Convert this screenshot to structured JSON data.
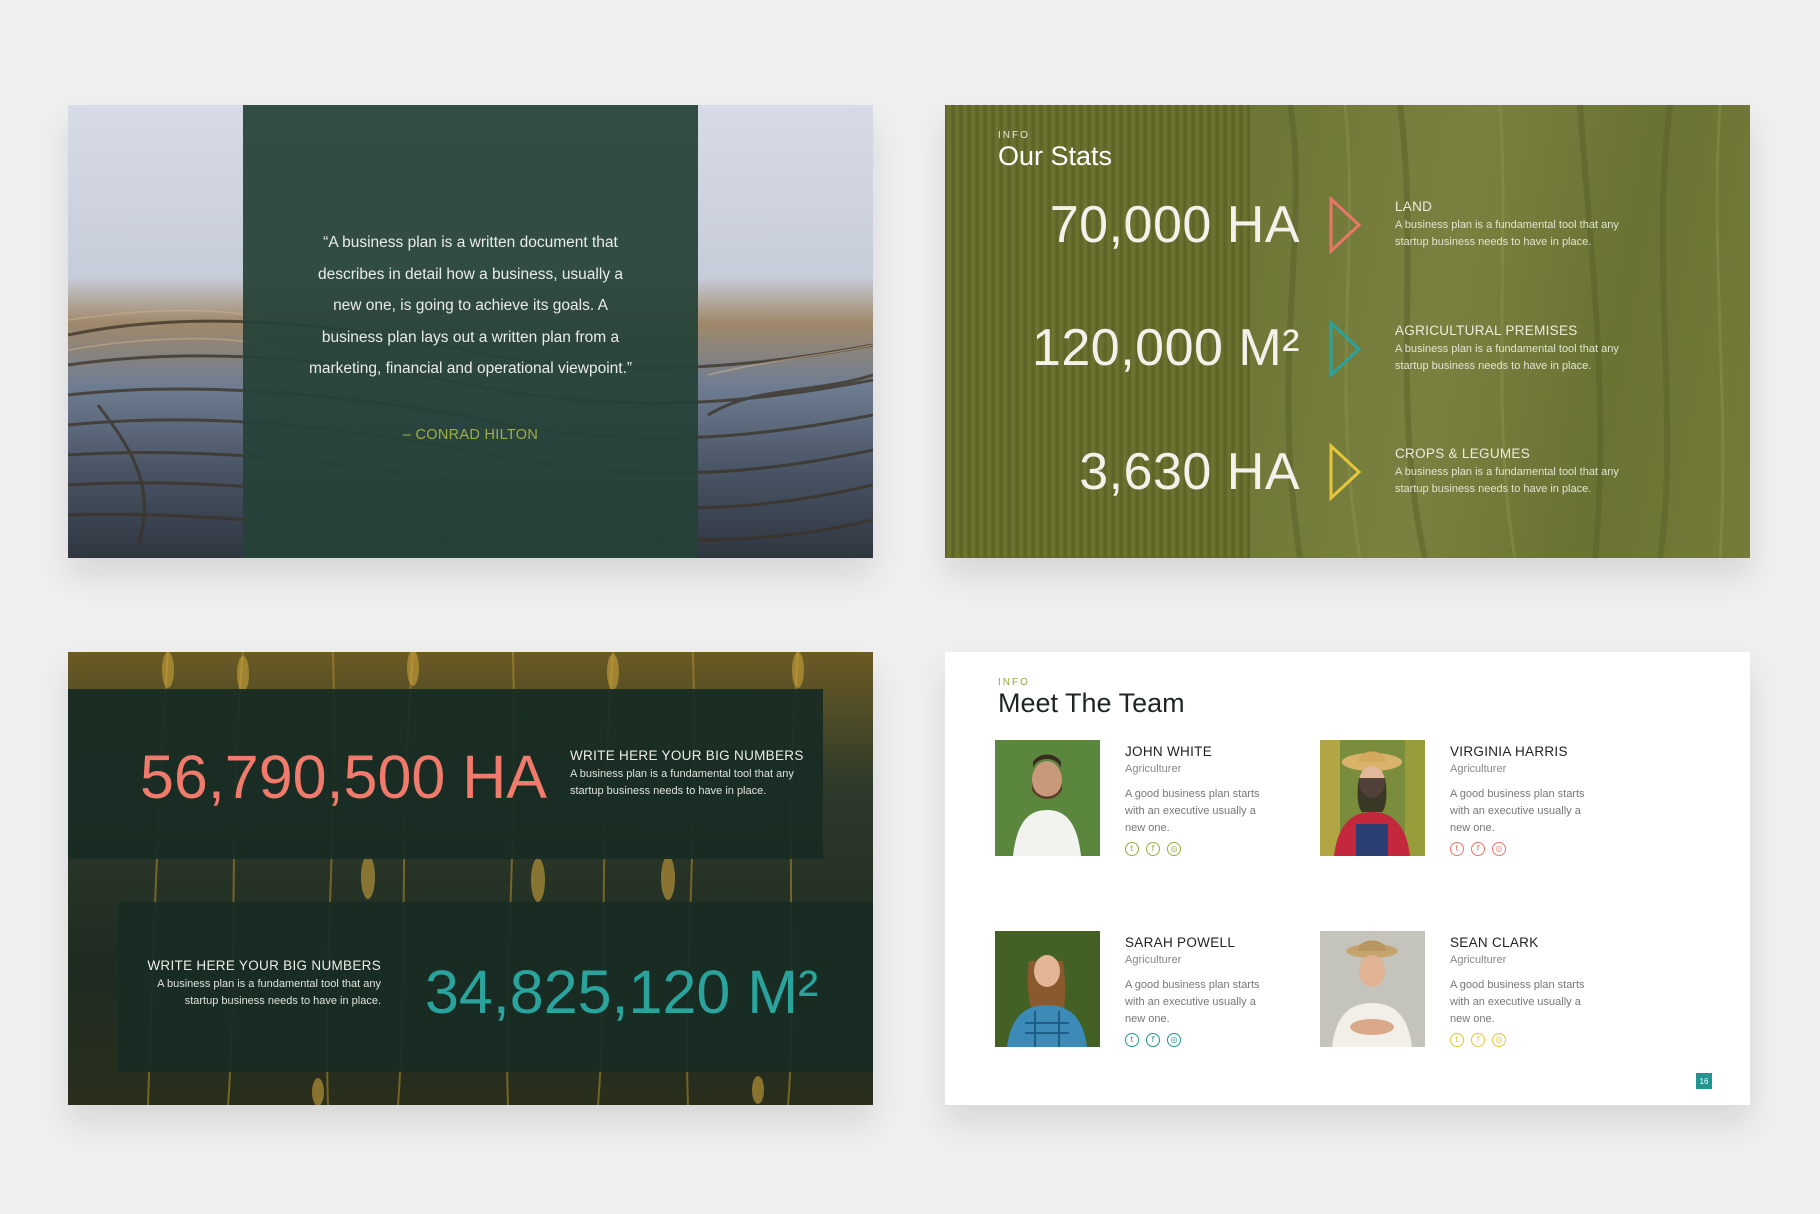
{
  "quote_slide": {
    "quote": "“A business plan is a written document that describes in detail how a business, usually a new one, is going to achieve its goals. A business plan lays out a written plan from a marketing, financial and operational viewpoint.”",
    "author": "– CONRAD HILTON"
  },
  "stats_slide": {
    "eyebrow": "INFO",
    "title": "Our Stats",
    "stats": [
      {
        "number": "70,000 HA",
        "label": "LAND",
        "desc": "A business plan is a fundamental tool that any startup business needs to have in place.",
        "color": "#e8776a"
      },
      {
        "number": "120,000 M²",
        "label": "AGRICULTURAL PREMISES",
        "desc": "A business plan is a fundamental tool that any startup business needs to have in place.",
        "color": "#2aa39d"
      },
      {
        "number": "3,630 HA",
        "label": "CROPS & LEGUMES",
        "desc": "A business plan is a fundamental tool that any startup business needs to have in place.",
        "color": "#e6c63a"
      }
    ]
  },
  "big_numbers_slide": {
    "first": {
      "number": "56,790,500 HA",
      "heading": "WRITE HERE YOUR BIG NUMBERS",
      "desc": "A business plan is a fundamental tool that any startup business needs to have in place.",
      "color": "#f07a6b"
    },
    "second": {
      "number": "34,825,120 M²",
      "heading": "WRITE HERE YOUR BIG NUMBERS",
      "desc": "A business plan is a fundamental tool that any startup business needs to have in place.",
      "color": "#2aa39d"
    }
  },
  "team_slide": {
    "eyebrow": "INFO",
    "title": "Meet The Team",
    "page_number": "16",
    "members": [
      {
        "name": "JOHN WHITE",
        "role": "Agriculturer",
        "desc": "A good business plan starts with an executive usually a new one.",
        "accent": "#9aaa3c",
        "socials": [
          "twitter-icon",
          "facebook-icon",
          "instagram-icon"
        ]
      },
      {
        "name": "VIRGINIA HARRIS",
        "role": "Agriculturer",
        "desc": "A good business plan starts with an executive usually a new one.",
        "accent": "#e8776a",
        "socials": [
          "twitter-icon",
          "facebook-icon",
          "instagram-icon"
        ]
      },
      {
        "name": "SARAH POWELL",
        "role": "Agriculturer",
        "desc": "A good business plan starts with an executive usually a new one.",
        "accent": "#1f9690",
        "socials": [
          "twitter-icon",
          "facebook-icon",
          "instagram-icon"
        ]
      },
      {
        "name": "SEAN CLARK",
        "role": "Agriculturer",
        "desc": "A good business plan starts with an executive usually a new one.",
        "accent": "#e6c63a",
        "socials": [
          "twitter-icon",
          "facebook-icon",
          "instagram-icon"
        ]
      }
    ]
  }
}
